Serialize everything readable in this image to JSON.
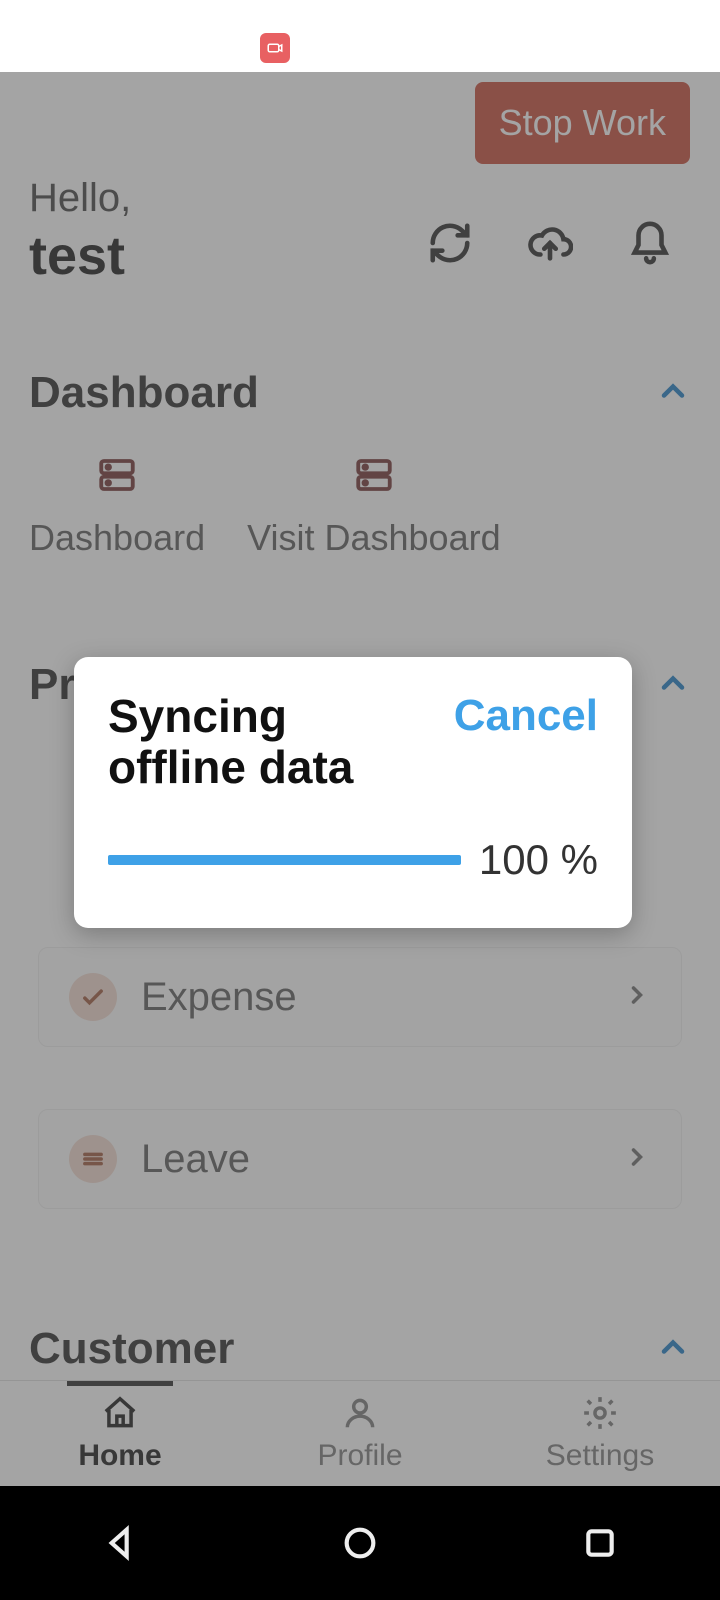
{
  "header": {
    "stop_work_label": "Stop Work",
    "greeting_line1": "Hello,",
    "greeting_line2": "test"
  },
  "sections": {
    "dashboard_title": "Dashboard",
    "pr_title_visible": "Pr",
    "customer_title": "Customer"
  },
  "dashboard_items": [
    {
      "label": "Dashboard"
    },
    {
      "label": "Visit Dashboard"
    }
  ],
  "list_items": {
    "expense_label": "Expense",
    "leave_label": "Leave"
  },
  "dialog": {
    "title": "Syncing offline data",
    "cancel_label": "Cancel",
    "progress_percent_text": "100 %",
    "progress_percent_value": 100
  },
  "tabs": {
    "home": "Home",
    "profile": "Profile",
    "settings": "Settings",
    "active": "home"
  },
  "icons": {
    "refresh": "refresh-icon",
    "cloud_upload": "cloud-upload-icon",
    "bell": "bell-icon",
    "chevron_up": "chevron-up-icon",
    "chevron_right": "chevron-right-icon",
    "server": "server-icon",
    "check": "check-icon",
    "lines": "lines-icon",
    "home": "home-icon",
    "profile": "profile-icon",
    "gear": "gear-icon",
    "rec": "screen-record-icon",
    "nav_back": "nav-back-icon",
    "nav_home": "nav-home-icon",
    "nav_recent": "nav-recent-icon"
  },
  "colors": {
    "accent_blue": "#3ea1e7",
    "danger_red": "#c54531",
    "brown_icon": "#6e2a2a",
    "badge_bg": "#f1d8cc"
  }
}
